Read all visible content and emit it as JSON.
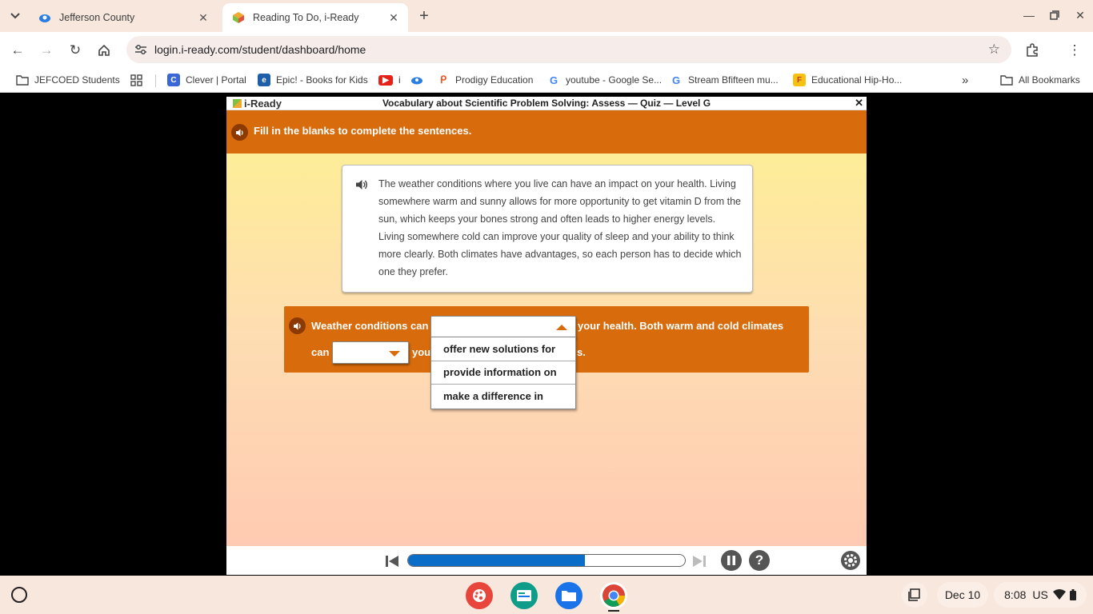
{
  "browser": {
    "tabs": [
      {
        "title": "Jefferson County",
        "active": false
      },
      {
        "title": "Reading To Do, i-Ready",
        "active": true
      }
    ],
    "url": "login.i-ready.com/student/dashboard/home"
  },
  "bookmarks": {
    "items": [
      {
        "label": "JEFCOED Students"
      },
      {
        "label": "Clever | Portal"
      },
      {
        "label": "Epic! - Books for Kids"
      },
      {
        "label": "i"
      },
      {
        "label": "Prodigy Education"
      },
      {
        "label": "youtube - Google Se..."
      },
      {
        "label": "Stream Bfifteen mu..."
      },
      {
        "label": "Educational Hip-Ho..."
      }
    ],
    "all_bookmarks": "All Bookmarks"
  },
  "app": {
    "logo": "i-Ready",
    "title": "Vocabulary about Scientific Problem Solving: Assess — Quiz — Level G",
    "instruction": "Fill in the blanks to complete the sentences.",
    "passage": "The weather conditions where you live can have an impact on your health. Living somewhere warm and sunny allows for more opportunity to get vitamin D from the sun, which keeps your bones strong and often leads to higher energy levels. Living somewhere cold can improve your quality of sleep and your ability to think more clearly. Both climates have advantages, so each person has to decide which one they prefer.",
    "question": {
      "part1": "Weather conditions can",
      "part2": "your health. Both warm and cold climates",
      "part3": "can",
      "part4": "you",
      "part5": "s.",
      "dropdown1_value": "",
      "dropdown2_value": "",
      "options": [
        "offer new solutions for",
        "provide information on",
        "make a difference in"
      ]
    },
    "progress": 0.64,
    "help_label": "?"
  },
  "shelf": {
    "date": "Dec 10",
    "time": "8:08",
    "locale": "US"
  }
}
